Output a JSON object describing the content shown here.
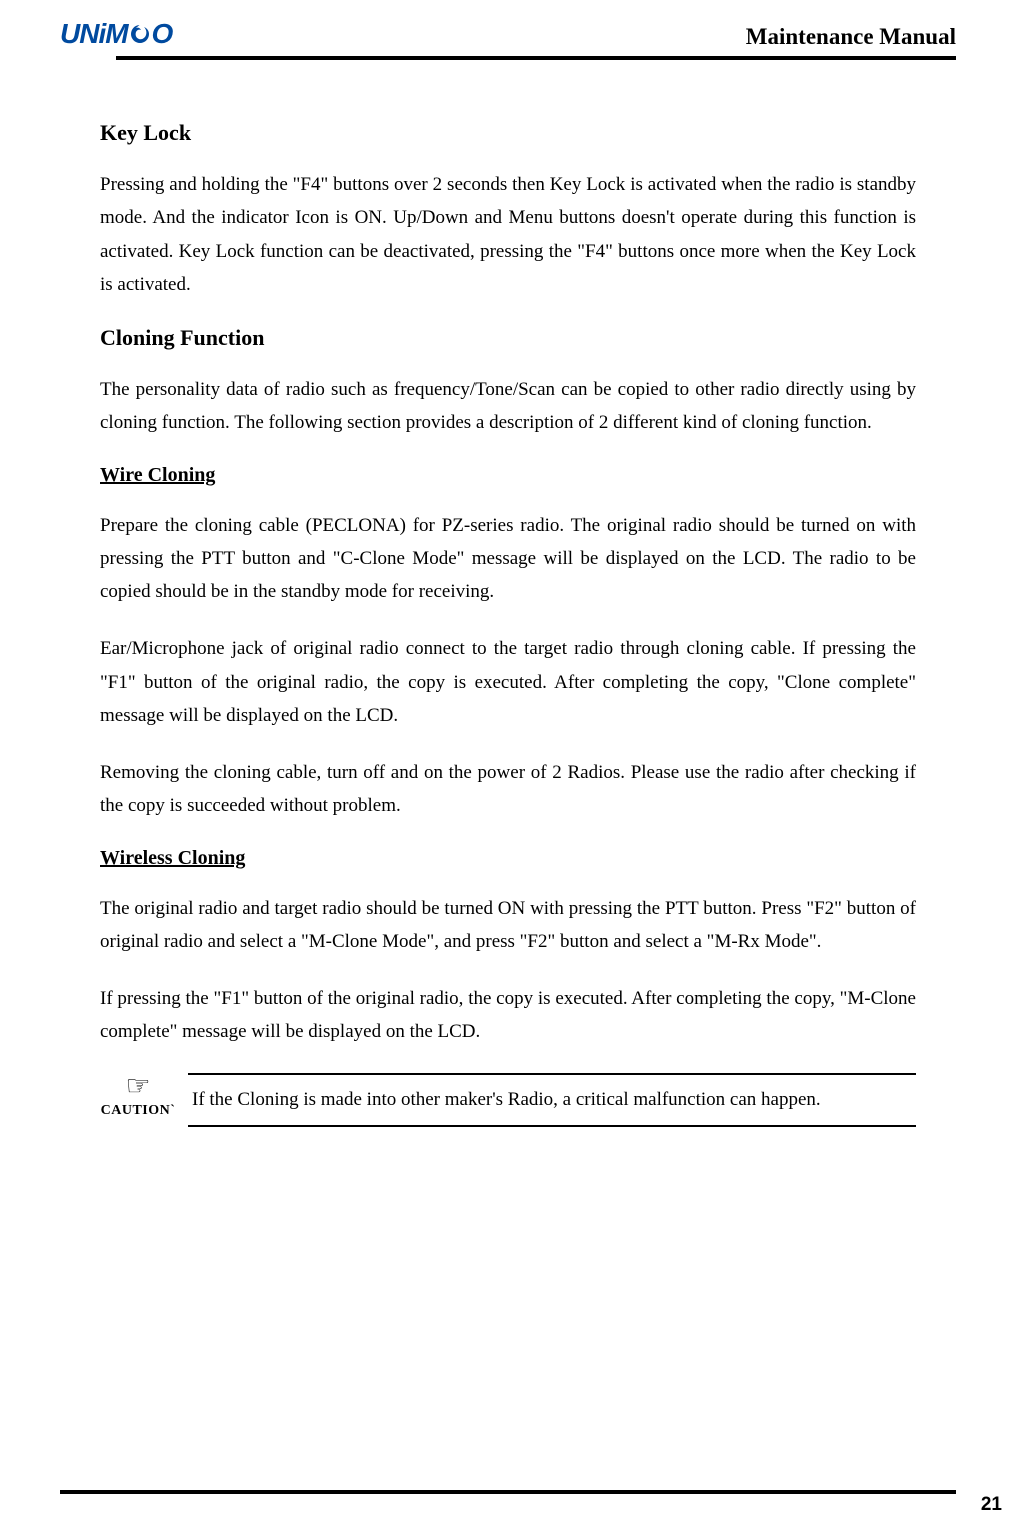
{
  "header": {
    "logo_text_1": "UNiM",
    "logo_text_2": "O",
    "title": "Maintenance Manual"
  },
  "sections": {
    "key_lock": {
      "heading": "Key Lock",
      "p1": "Pressing and holding the \"F4\" buttons over 2 seconds then Key Lock is activated when the radio is standby mode. And the indicator Icon is ON. Up/Down and Menu buttons doesn't operate during this function is activated.   Key Lock function can be deactivated, pressing the \"F4\" buttons once more when the Key Lock is activated."
    },
    "cloning": {
      "heading": "Cloning Function",
      "p1": "The personality data of radio such as frequency/Tone/Scan can be copied to other radio directly using by cloning function. The following section provides a description of 2 different kind of cloning function."
    },
    "wire_cloning": {
      "heading": "Wire Cloning",
      "p1": "Prepare the cloning cable (PECLONA) for PZ-series radio. The original radio should be turned on with pressing the PTT button and \"C-Clone Mode\" message will be displayed on the LCD. The radio to be copied should be in the standby mode for receiving.",
      "p2": "Ear/Microphone jack of original radio connect to the target radio through cloning cable. If pressing the \"F1\" button of the original radio, the copy is executed. After completing the copy, \"Clone complete\" message will be displayed on the LCD.",
      "p3": "Removing the cloning cable, turn off and on the power of 2 Radios. Please use the radio after checking if the copy is succeeded without problem."
    },
    "wireless_cloning": {
      "heading": "Wireless Cloning ",
      "p1": "The original radio and target radio should be turned ON with pressing the PTT button. Press \"F2\" button of original radio and select a \"M-Clone Mode\", and press \"F2\" button and select a \"M-Rx Mode\".",
      "p2": "If pressing the \"F1\" button of the original radio, the copy is executed. After completing the copy, \"M-Clone complete\" message will be displayed on the LCD."
    },
    "caution": {
      "icon": "☞",
      "label": "CAUTION`",
      "text": "If the Cloning is made into other maker's Radio, a critical malfunction can happen."
    }
  },
  "footer": {
    "page_number": "21"
  }
}
